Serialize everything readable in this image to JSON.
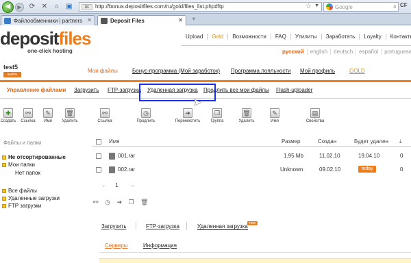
{
  "browser": {
    "url": "http://bonus.depositfiles.com/ru/gold/files_list.php#ftp",
    "url_favicon": "DF",
    "search_placeholder": "Google",
    "corner_logo": "CF",
    "tabs": [
      {
        "label": "Файлообменники | partners",
        "icon_color": "#3a7cc7"
      },
      {
        "label": "Deposit Files",
        "icon_color": "#555555"
      }
    ],
    "new_tab": "+"
  },
  "logo": {
    "word_main": "deposit",
    "word_accent": "files",
    "tagline": "one-click hosting"
  },
  "top_menu": [
    "Upload",
    "Gold",
    "Возможности",
    "FAQ",
    "Утилиты",
    "Заработать",
    "Loyalty",
    "Контакты"
  ],
  "languages": [
    "русский",
    "english",
    "deutsch",
    "español",
    "portuguese"
  ],
  "user": {
    "name": "test5",
    "logout": "выйти"
  },
  "main_nav": [
    "Мои файлы",
    "Бонус-программа (Мой заработок)",
    "Программа лояльности",
    "Мой профиль",
    "GOLD"
  ],
  "sub_nav": [
    "Управление файлами",
    "Загрузить",
    "FTP-загрузка",
    "Удаленная загрузка",
    "Продлить все мои файлы",
    "Flash-uploader"
  ],
  "toolbar_left": [
    "Создать",
    "Ссылка",
    "Имя",
    "Удалить"
  ],
  "toolbar_right": [
    "Ссылка",
    "Продлить",
    "Переместить",
    "Группа",
    "Удалить",
    "Имя",
    "Свойства"
  ],
  "left_panel": {
    "title": "Файлы и папки",
    "tree": [
      "Не отсортированные",
      "Мои папки",
      "Нет папок",
      "Все файлы",
      "Удаленные загрузки",
      "FTP загрузки"
    ]
  },
  "file_table": {
    "headers": [
      "Имя",
      "Размер",
      "Создан",
      "Будет удален"
    ],
    "rows": [
      {
        "name": "001.rar",
        "size": "1.95 Mb",
        "created": "11.02.10",
        "expires": "19.04.10",
        "count": "0"
      },
      {
        "name": "002.rar",
        "size": "Unknown",
        "created": "09.02.10",
        "expires": "today",
        "count": "0"
      }
    ],
    "pager": "1"
  },
  "upload_tabs": [
    "Загрузить",
    "FTP-загрузка",
    "Удаленная загрузка"
  ],
  "new_badge": "new",
  "server_tabs": [
    "Серверы",
    "Информация"
  ],
  "colors": {
    "accent": "#ee7d1a",
    "highlight": "#1a2ef0",
    "gold": "#d9901a"
  }
}
